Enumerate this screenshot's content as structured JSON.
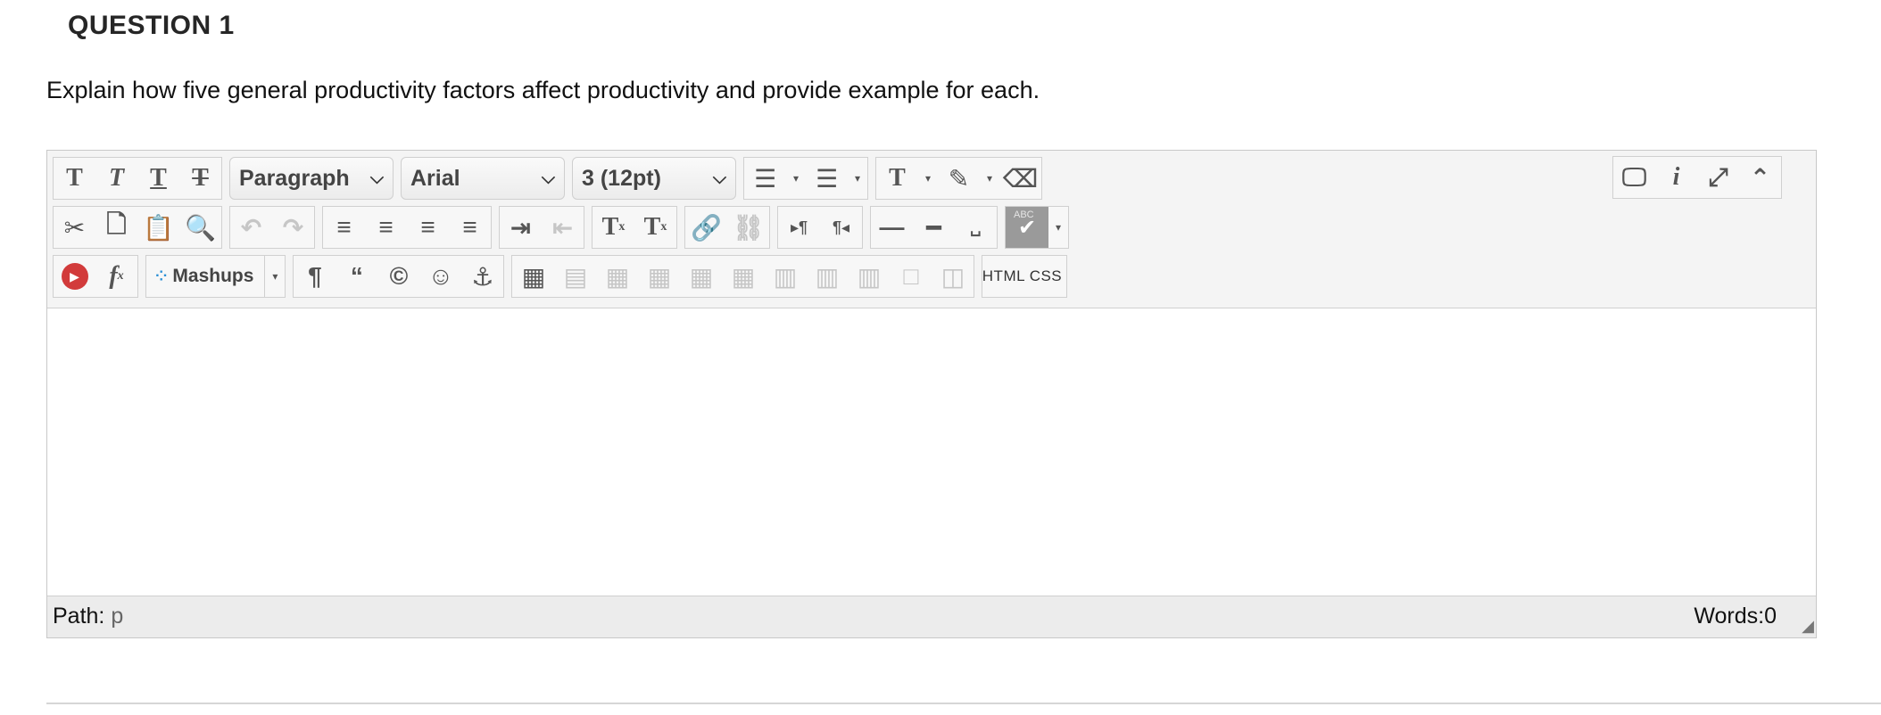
{
  "question": {
    "title": "QUESTION 1",
    "text": "Explain how five general productivity factors affect productivity and provide example for each."
  },
  "toolbar": {
    "row1": {
      "format_buttons": [
        {
          "name": "bold-icon",
          "glyph": "T"
        },
        {
          "name": "italic-icon",
          "glyph": "T"
        },
        {
          "name": "underline-icon",
          "glyph": "T"
        },
        {
          "name": "strikethrough-icon",
          "glyph": "T"
        }
      ],
      "paragraph_select": "Paragraph",
      "font_select": "Arial",
      "size_select": "3 (12pt)"
    },
    "row3": {
      "mashups_label": "Mashups",
      "html_label": "HTML",
      "css_label": "CSS"
    }
  },
  "status": {
    "path_label": "Path:",
    "path_value": "p",
    "words_label": "Words:0"
  },
  "colors": {
    "toolbar_bg": "#f4f4f4",
    "status_bg": "#ececec",
    "youtube_red": "#d23b3b",
    "mashup_blue": "#2a8fd6"
  }
}
